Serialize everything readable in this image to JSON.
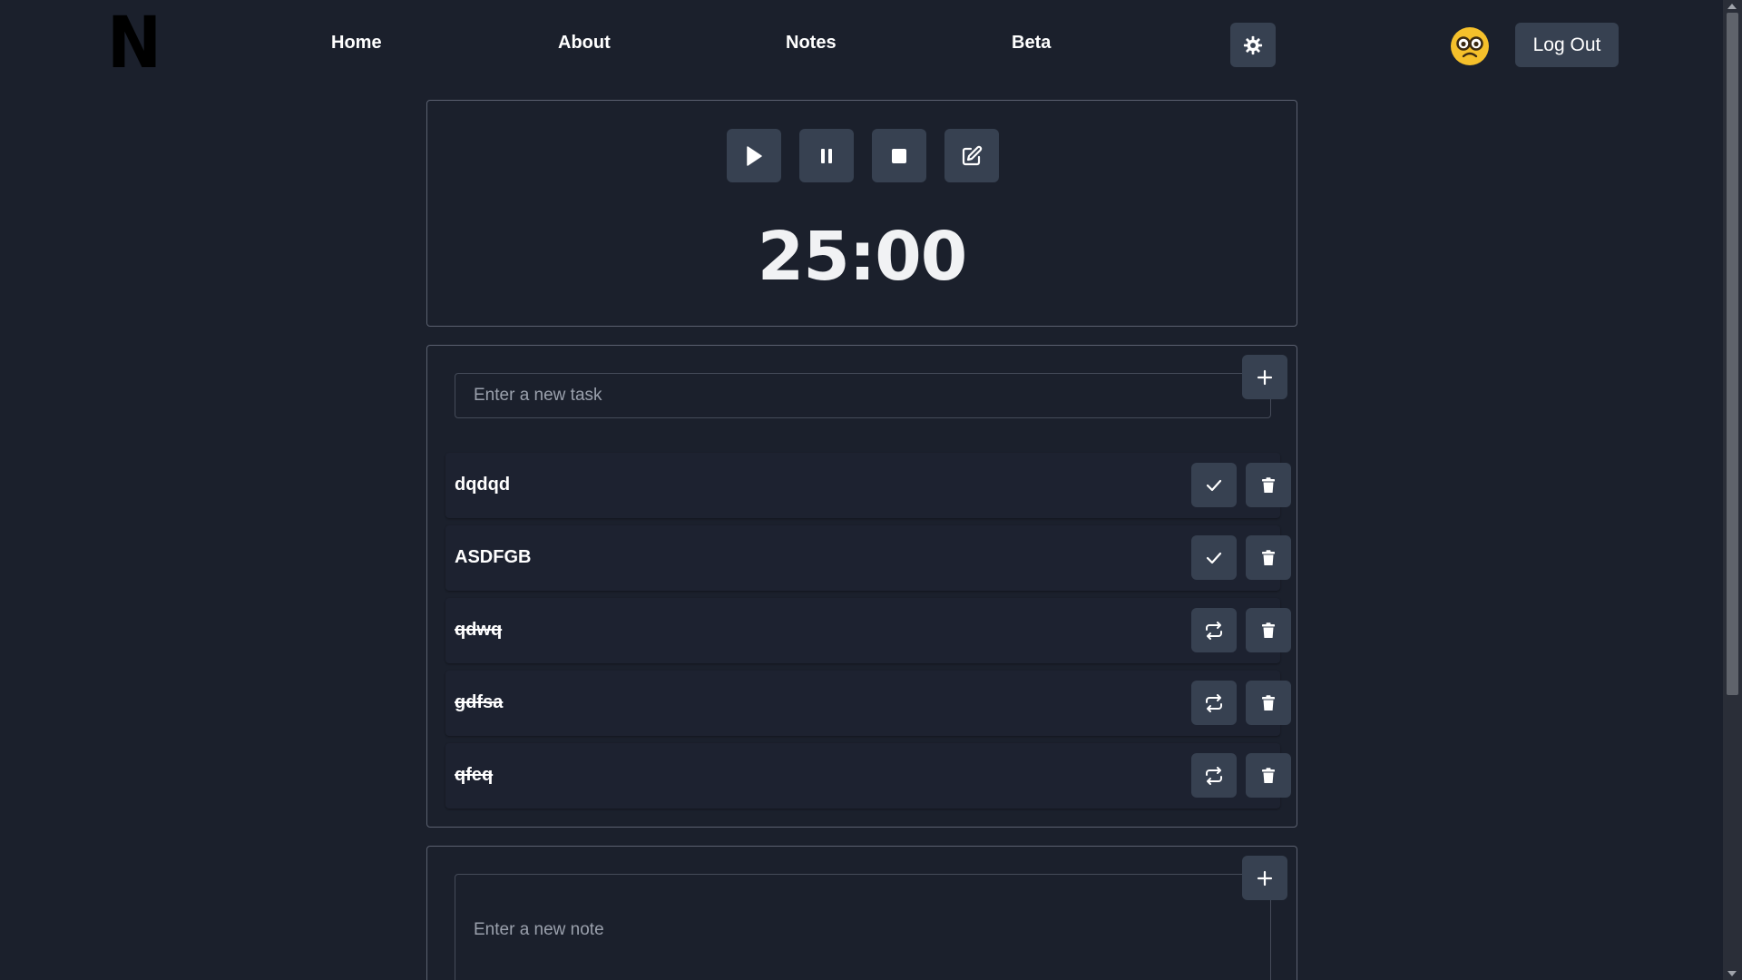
{
  "header": {
    "logo": "N",
    "nav": [
      {
        "label": "Home"
      },
      {
        "label": "About"
      },
      {
        "label": "Notes"
      },
      {
        "label": "Beta"
      }
    ],
    "theme_icon": "gear-icon",
    "avatar_icon": "nerd-face-emoji-icon",
    "logout_label": "Log Out"
  },
  "timer": {
    "controls": [
      {
        "icon": "play-icon"
      },
      {
        "icon": "pause-icon"
      },
      {
        "icon": "stop-icon"
      },
      {
        "icon": "edit-icon"
      }
    ],
    "display": "25:00"
  },
  "tasks": {
    "input_placeholder": "Enter a new task",
    "add_icon": "plus-icon",
    "items": [
      {
        "text": "dqdqd",
        "completed": false,
        "action_icon": "check-icon"
      },
      {
        "text": "ASDFGB",
        "completed": false,
        "action_icon": "check-icon"
      },
      {
        "text": "qdwq",
        "completed": true,
        "action_icon": "repeat-icon"
      },
      {
        "text": "gdfsa",
        "completed": true,
        "action_icon": "repeat-icon"
      },
      {
        "text": "qfeq",
        "completed": true,
        "action_icon": "repeat-icon"
      }
    ]
  },
  "notes": {
    "input_placeholder": "Enter a new note",
    "add_icon": "plus-icon"
  },
  "colors": {
    "background": "#1b202c",
    "button": "#374151",
    "border": "#5b6170",
    "text": "#ffffff",
    "avatar": "#f5c02b"
  }
}
